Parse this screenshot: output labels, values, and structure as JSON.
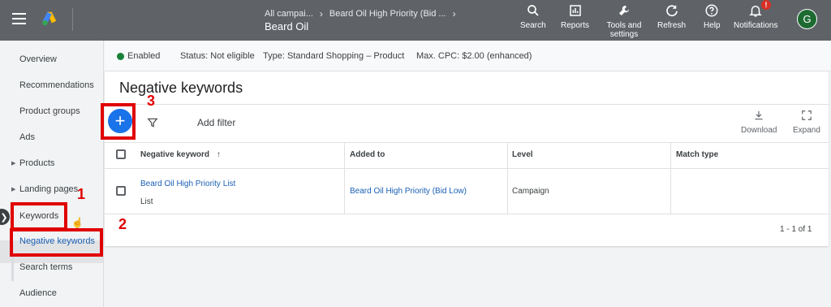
{
  "header": {
    "breadcrumb": [
      "All campai...",
      "Beard Oil High Priority (Bid ..."
    ],
    "campaign": "Beard Oil",
    "nav": [
      {
        "label": "Search",
        "icon": "search-icon"
      },
      {
        "label": "Reports",
        "icon": "reports-icon"
      },
      {
        "label": "Tools and settings",
        "icon": "wrench-icon"
      },
      {
        "label": "Refresh",
        "icon": "refresh-icon"
      },
      {
        "label": "Help",
        "icon": "help-icon"
      },
      {
        "label": "Notifications",
        "icon": "bell-icon"
      }
    ],
    "notification_badge": "!",
    "avatar_letter": "G"
  },
  "sidebar": {
    "items": [
      {
        "label": "Overview"
      },
      {
        "label": "Recommendations"
      },
      {
        "label": "Product groups"
      },
      {
        "label": "Ads"
      },
      {
        "label": "Products"
      },
      {
        "label": "Landing pages"
      },
      {
        "label": "Keywords"
      },
      {
        "label": "Negative keywords"
      },
      {
        "label": "Search terms"
      },
      {
        "label": "Audience"
      }
    ]
  },
  "status": {
    "enabled": "Enabled",
    "status": "Status: Not eligible",
    "type": "Type: Standard Shopping – Product",
    "max_cpc": "Max. CPC: $2.00 (enhanced)"
  },
  "main": {
    "title": "Negative keywords",
    "add_filter": "Add filter",
    "download": "Download",
    "expand": "Expand",
    "columns": [
      "Negative keyword",
      "Added to",
      "Level",
      "Match type"
    ],
    "sort_arrow": "↑",
    "rows": [
      {
        "keyword": "Beard Oil High Priority List",
        "keyword_sub": "List",
        "added_to": "Beard Oil High Priority (Bid Low)",
        "level": "Campaign",
        "match_type": ""
      }
    ],
    "pagination": "1 - 1 of 1"
  },
  "annotations": {
    "step1": "1",
    "step2": "2",
    "step3": "3"
  },
  "colors": {
    "topbar": "#5f6368",
    "accent": "#1a73e8",
    "annotation": "#e00000",
    "enabled_dot": "#188038"
  }
}
